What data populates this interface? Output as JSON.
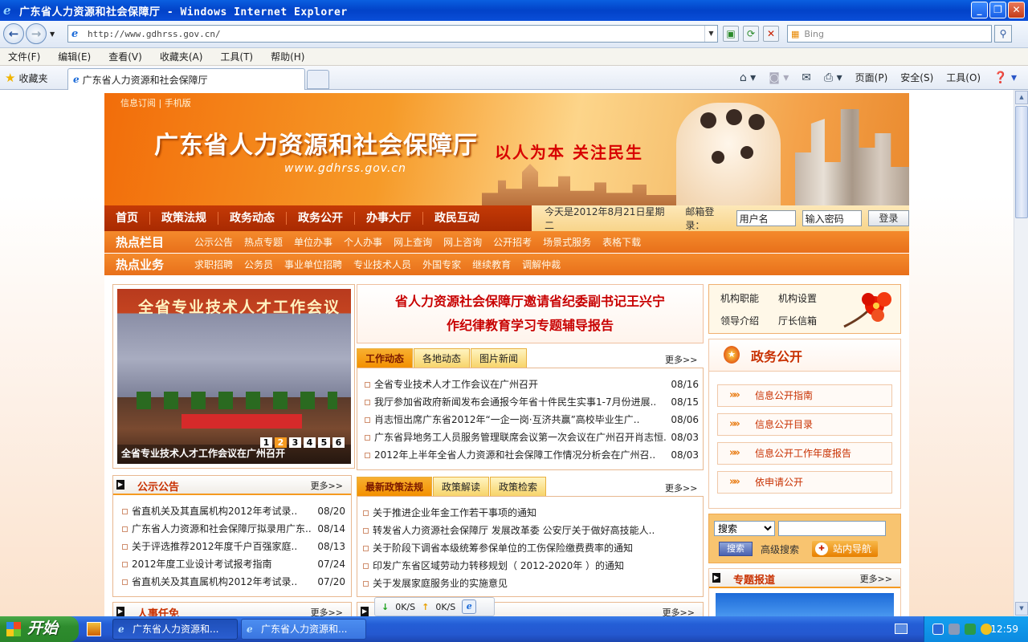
{
  "window": {
    "title": "广东省人力资源和社会保障厅 - Windows Internet Explorer"
  },
  "browser": {
    "url": "http://www.gdhrss.gov.cn/",
    "search_placeholder": "Bing",
    "menu": [
      "文件(F)",
      "编辑(E)",
      "查看(V)",
      "收藏夹(A)",
      "工具(T)",
      "帮助(H)"
    ],
    "favorites_label": "收藏夹",
    "tab_title": "广东省人力资源和社会保障厅",
    "commands": {
      "page": "页面(P)",
      "safety": "安全(S)",
      "tools": "工具(O)"
    }
  },
  "site": {
    "top_links": "信息订阅 | 手机版",
    "name": "广东省人力资源和社会保障厅",
    "domain": "www.gdhrss.gov.cn",
    "slogan": "以人为本  关注民生",
    "nav": [
      "首页",
      "政策法规",
      "政务动态",
      "政务公开",
      "办事大厅",
      "政民互动"
    ],
    "date_text": "今天是2012年8月21日星期二",
    "login_label": "邮箱登录：",
    "username_value": "用户名",
    "password_value": "输入密码",
    "login_button": "登录",
    "hot_columns": {
      "label": "热点栏目",
      "links": [
        "公示公告",
        "热点专题",
        "单位办事",
        "个人办事",
        "网上查询",
        "网上咨询",
        "公开招考",
        "场景式服务",
        "表格下载"
      ]
    },
    "hot_business": {
      "label": "热点业务",
      "links": [
        "求职招聘",
        "公务员",
        "事业单位招聘",
        "专业技术人员",
        "外国专家",
        "继续教育",
        "调解仲裁"
      ]
    },
    "slideshow": {
      "banner_text": "全省专业技术人才工作会议",
      "caption": "全省专业技术人才工作会议在广州召开",
      "pages": [
        "1",
        "2",
        "3",
        "4",
        "5",
        "6"
      ],
      "active_page": 2
    },
    "headline": {
      "line1": "省人力资源社会保障厅邀请省纪委副书记王兴宁",
      "line2": "作纪律教育学习专题辅导报告"
    },
    "news": {
      "tabs": [
        "工作动态",
        "各地动态",
        "图片新闻"
      ],
      "more": "更多>>",
      "items": [
        {
          "title": "全省专业技术人才工作会议在广州召开",
          "date": "08/16"
        },
        {
          "title": "我厅参加省政府新闻发布会通报今年省十件民生实事1-7月份进展..",
          "date": "08/15"
        },
        {
          "title": "肖志恒出席广东省2012年“一企一岗·互济共赢”高校毕业生广..",
          "date": "08/06"
        },
        {
          "title": "广东省异地务工人员服务管理联席会议第一次会议在广州召开肖志恒..",
          "date": "08/03"
        },
        {
          "title": "2012年上半年全省人力资源和社会保障工作情况分析会在广州召..",
          "date": "08/03"
        }
      ]
    },
    "notices": {
      "title": "公示公告",
      "more": "更多>>",
      "items": [
        {
          "title": "省直机关及其直属机构2012年考试录..",
          "date": "08/20"
        },
        {
          "title": "广东省人力资源和社会保障厅拟录用广东..",
          "date": "08/14"
        },
        {
          "title": "关于评选推荐2012年度千户百强家庭..",
          "date": "08/13"
        },
        {
          "title": "2012年度工业设计考试报考指南",
          "date": "07/24"
        },
        {
          "title": "省直机关及其直属机构2012年考试录..",
          "date": "07/20"
        }
      ]
    },
    "policy": {
      "tabs": [
        "最新政策法规",
        "政策解读",
        "政策检索"
      ],
      "more": "更多>>",
      "items": [
        "关于推进企业年金工作若干事项的通知",
        "转发省人力资源社会保障厅  发展改革委  公安厅关于做好高技能人..",
        "关于阶段下调省本级统筹参保单位的工伤保险缴费费率的通知",
        "印发广东省区域劳动力转移规划（ 2012-2020年 ）的通知",
        "关于发展家庭服务业的实施意见"
      ]
    },
    "personnel": {
      "title": "人事任免",
      "more": "更多>>"
    },
    "bottom_more": "更多>>",
    "org": {
      "items": [
        "机构职能",
        "机构设置",
        "领导介绍",
        "厅长信箱"
      ]
    },
    "gov_open": {
      "title": "政务公开",
      "items": [
        "信息公开指南",
        "信息公开目录",
        "信息公开工作年度报告",
        "依申请公开"
      ]
    },
    "search": {
      "select_value": "搜索",
      "button": "搜索",
      "advanced": "高级搜索",
      "site_nav": "站内导航"
    },
    "special": {
      "title": "专题报道",
      "more": "更多>>"
    }
  },
  "download_bar": {
    "down": "0K/S",
    "up": "0K/S"
  },
  "taskbar": {
    "start": "开始",
    "tasks": [
      "广东省人力资源和...",
      "广东省人力资源和..."
    ],
    "clock": "12:59"
  }
}
